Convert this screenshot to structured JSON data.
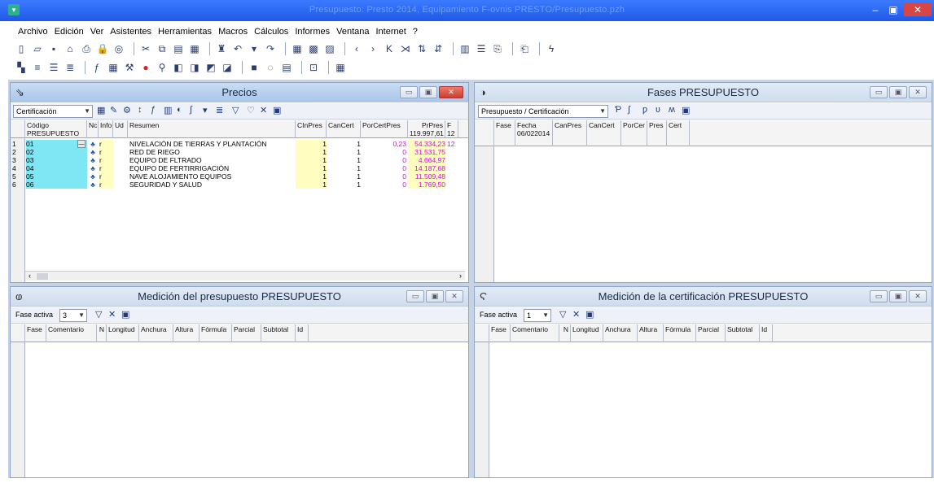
{
  "app": {
    "title": "Presupuesto: Presto 2014, Equipamiento F-ovnis PRESTO/Presupuesto.pzh",
    "colors": {
      "titlebar": "#2a63f0",
      "close": "#d84545",
      "highlight_cyan": "#7fe6f3",
      "highlight_yellow": "#fffec0",
      "magenta": "#d10fd8"
    }
  },
  "menu": [
    "Archivo",
    "Edición",
    "Ver",
    "Asistentes",
    "Herramientas",
    "Macros",
    "Cálculos",
    "Informes",
    "Ventana",
    "Internet",
    "?"
  ],
  "toolbar1_icons": [
    "new-doc-icon",
    "open-folder-icon",
    "save-icon",
    "home-icon",
    "print-icon",
    "lock-icon",
    "preview-icon",
    "cut-icon",
    "copy-icon",
    "paste-icon",
    "clipboard-icon",
    "binoculars-icon",
    "undo-icon",
    "dropdown-icon",
    "redo-icon",
    "grid-icon",
    "close-grid-icon",
    "delete-row-icon",
    "nav-prev-icon",
    "nav-next-icon",
    "nav-first-icon",
    "nav-last-icon",
    "sort-asc-icon",
    "sort-desc-icon",
    "table-icon",
    "columns-icon",
    "export-icon",
    "import-icon",
    "help-icon"
  ],
  "toolbar2_icons": [
    "window-icon",
    "align-left-icon",
    "align-center-icon",
    "align-right-icon",
    "formula-icon",
    "calc-icon",
    "chart-icon",
    "red-dot-icon",
    "tree-icon",
    "stack-icon",
    "stack2-icon",
    "stack3-icon",
    "stack4-icon",
    "block-icon",
    "circle-icon",
    "sheet-icon",
    "sheet2-icon",
    "layout-icon"
  ],
  "precios": {
    "title": "Precios",
    "combo": "Certificación",
    "columns": [
      "Código PRESUPUESTO",
      "Nc",
      "Info",
      "Ud",
      "Resumen",
      "CInPres",
      "CanCert",
      "PorCertPres",
      "PrPres 119.997,61",
      "F 12"
    ],
    "rows": [
      {
        "n": "1",
        "codigo": "01",
        "resumen": "NIVELACIÓN DE TIERRAS Y PLANTACIÓN",
        "canpres": "1",
        "cancert": "1",
        "porcert": "0,23",
        "prpres": "54.334,23",
        "f": "12"
      },
      {
        "n": "2",
        "codigo": "02",
        "resumen": "RED DE RIEGO",
        "canpres": "1",
        "cancert": "1",
        "porcert": "0",
        "prpres": "31.531,75",
        "f": ""
      },
      {
        "n": "3",
        "codigo": "03",
        "resumen": "EQUIPO DE FLTRADO",
        "canpres": "1",
        "cancert": "1",
        "porcert": "0",
        "prpres": "4.664,97",
        "f": ""
      },
      {
        "n": "4",
        "codigo": "04",
        "resumen": "EQUIPO DE FERTIRRIGACIÓN",
        "canpres": "1",
        "cancert": "1",
        "porcert": "0",
        "prpres": "14.187,68",
        "f": ""
      },
      {
        "n": "5",
        "codigo": "05",
        "resumen": "NAVE ALOJAMIENTO EQUIPOS",
        "canpres": "1",
        "cancert": "1",
        "porcert": "0",
        "prpres": "11.509,48",
        "f": ""
      },
      {
        "n": "6",
        "codigo": "06",
        "resumen": "SEGURIDAD Y SALUD",
        "canpres": "1",
        "cancert": "1",
        "porcert": "0",
        "prpres": "1.769,50",
        "f": ""
      }
    ],
    "info_value": "r"
  },
  "fases": {
    "title": "Fases PRESUPUESTO",
    "combo": "Presupuesto / Certificación",
    "columns": [
      "Fase",
      "Fecha",
      "CanPres",
      "CanCert",
      "PorCer",
      "Pres",
      "Cert"
    ],
    "fecha_sub": "06/022014"
  },
  "medicion": {
    "title": "Medición del presupuesto  PRESUPUESTO",
    "fase_label": "Fase activa",
    "fase_value": "3",
    "columns": [
      "Fase",
      "Comentario",
      "N",
      "Longitud",
      "Anchura",
      "Altura",
      "Fórmula",
      "Parcial",
      "Subtotal",
      "Id"
    ]
  },
  "certificacion": {
    "title": "Medición de la certificación  PRESUPUESTO",
    "fase_label": "Fase activa",
    "fase_value": "1",
    "columns": [
      "Fase",
      "Comentario",
      "N",
      "Longitud",
      "Anchura",
      "Altura",
      "Fórmula",
      "Parcial",
      "Subtotal",
      "Id"
    ]
  }
}
